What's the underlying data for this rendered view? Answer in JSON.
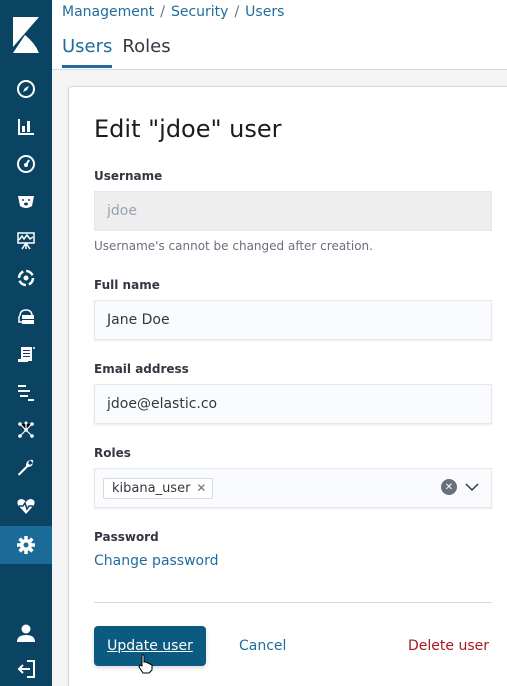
{
  "sidebar": {
    "logo": "kibana-logo",
    "items": [
      {
        "icon": "discover-icon",
        "active": false
      },
      {
        "icon": "visualize-icon",
        "active": false
      },
      {
        "icon": "dashboard-icon",
        "active": false
      },
      {
        "icon": "canvas-icon",
        "active": false
      },
      {
        "icon": "ml-icon",
        "active": false
      },
      {
        "icon": "apm-icon",
        "active": false
      },
      {
        "icon": "infrastructure-icon",
        "active": false
      },
      {
        "icon": "logs-icon",
        "active": false
      },
      {
        "icon": "timelion-icon",
        "active": false
      },
      {
        "icon": "graph-icon",
        "active": false
      },
      {
        "icon": "dev-tools-icon",
        "active": false
      },
      {
        "icon": "monitoring-icon",
        "active": false
      },
      {
        "icon": "management-icon",
        "active": true
      }
    ],
    "bottom": [
      {
        "icon": "user-icon"
      },
      {
        "icon": "logout-icon"
      }
    ]
  },
  "header": {
    "breadcrumbs": [
      "Management",
      "Security",
      "Users"
    ],
    "tabs": [
      {
        "label": "Users",
        "active": true
      },
      {
        "label": "Roles",
        "active": false
      }
    ]
  },
  "form": {
    "title": "Edit \"jdoe\" user",
    "username": {
      "label": "Username",
      "value": "jdoe",
      "help": "Username's cannot be changed after creation."
    },
    "full_name": {
      "label": "Full name",
      "value": "Jane Doe"
    },
    "email": {
      "label": "Email address",
      "value": "jdoe@elastic.co"
    },
    "roles": {
      "label": "Roles",
      "selected": [
        "kibana_user"
      ]
    },
    "password": {
      "label": "Password",
      "link": "Change password"
    },
    "actions": {
      "update": "Update user",
      "cancel": "Cancel",
      "delete": "Delete user"
    }
  },
  "colors": {
    "sidebar": "#0b4462",
    "accent": "#1f6d9c",
    "primary_button": "#0b5a82",
    "danger": "#a8171b"
  }
}
